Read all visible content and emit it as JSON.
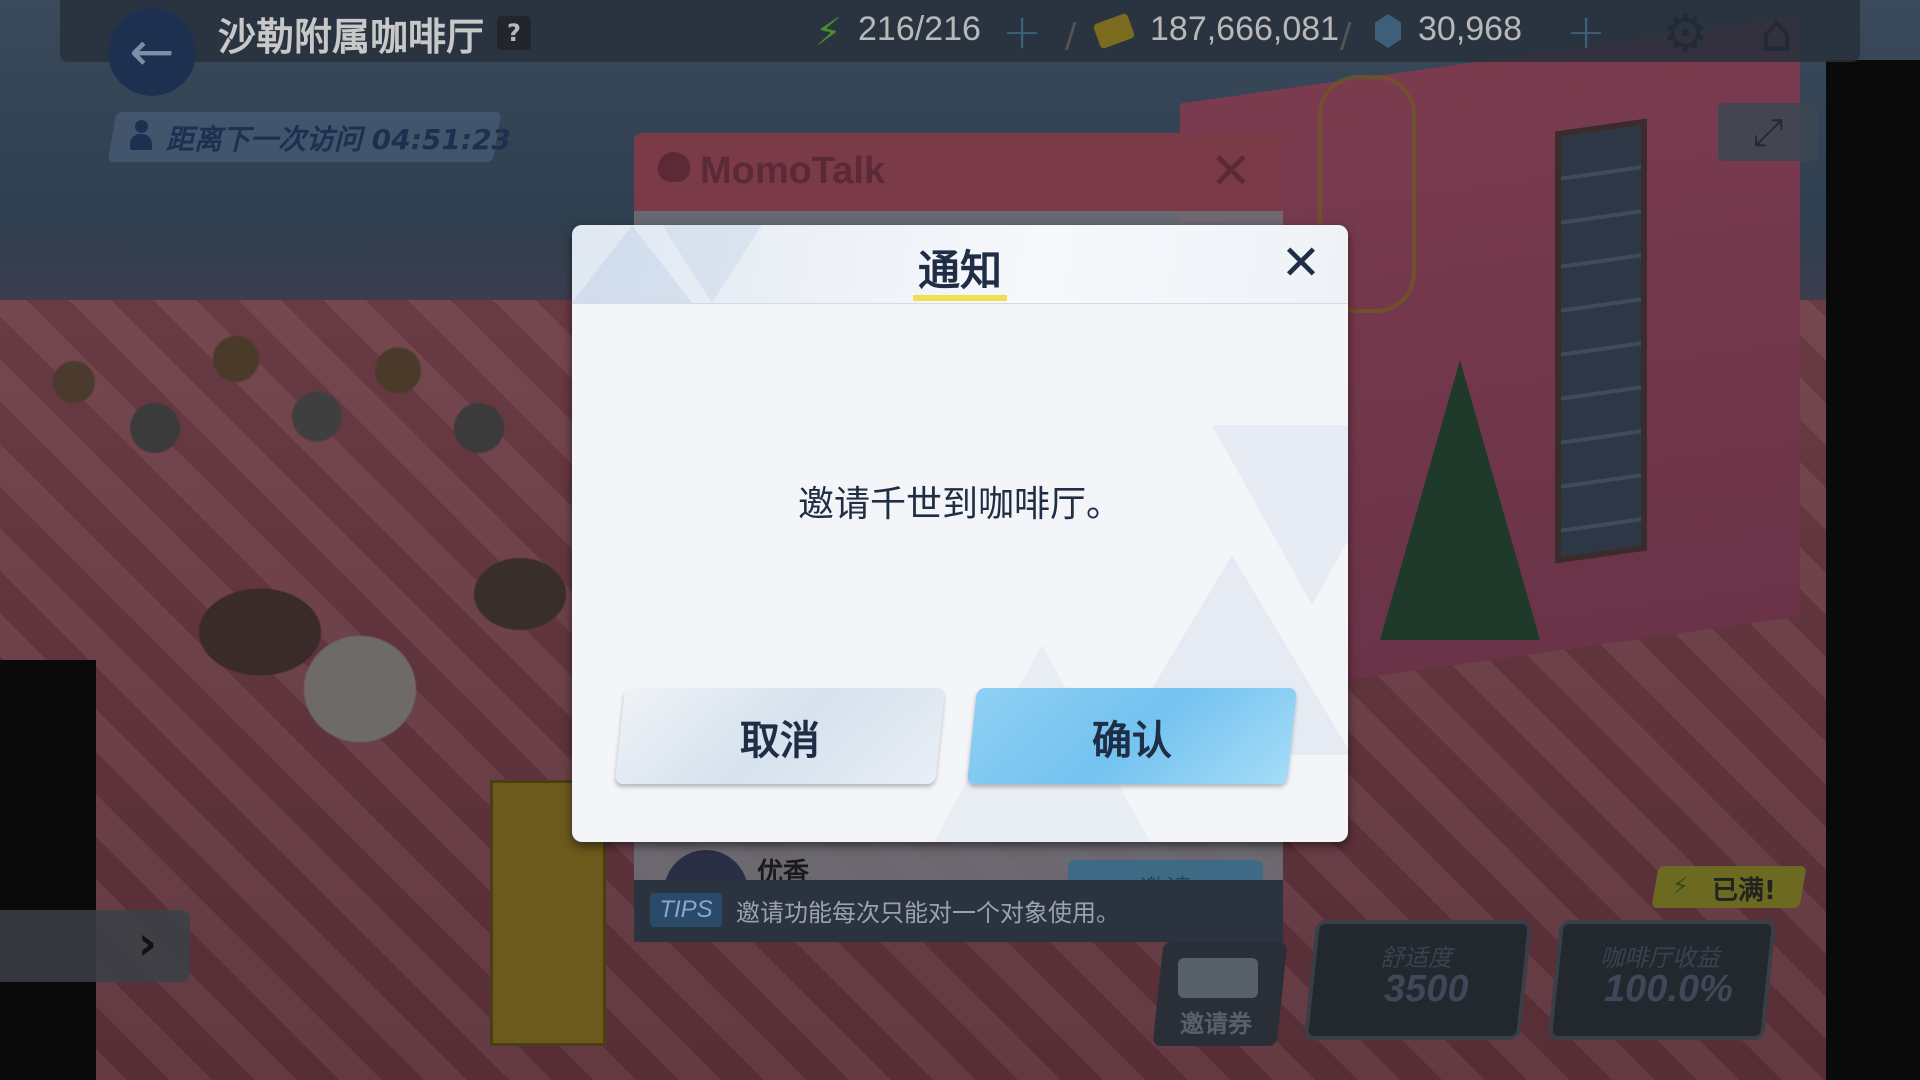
{
  "topbar": {
    "title": "沙勒附属咖啡厅",
    "help_label": "?",
    "ap": "216/216",
    "credits": "187,666,081",
    "gems": "30,968",
    "plus_label": "+"
  },
  "visit": {
    "label": "距离下一次访问 04:51:23"
  },
  "momotalk": {
    "title": "MomoTalk",
    "student_name": "优香",
    "invite_label": "邀请",
    "tips_badge": "TIPS",
    "tips_text": "邀请功能每次只能对一个对象使用。"
  },
  "cafe_stats": {
    "full_label": "已满!",
    "ticket_label": "邀请券",
    "comfort_label": "舒适度",
    "comfort_value": "3500",
    "income_label": "咖啡厅收益",
    "income_value": "100.0%"
  },
  "dialog": {
    "title": "通知",
    "message": "邀请千世到咖啡厅。",
    "cancel_label": "取消",
    "confirm_label": "确认"
  },
  "colors": {
    "dialog_bg": "#f3f5f8",
    "confirm_button": "#7ec8f2",
    "cancel_button": "#e2eaf2",
    "title_underline": "#f0e050",
    "text_dark": "#1f2e45"
  }
}
